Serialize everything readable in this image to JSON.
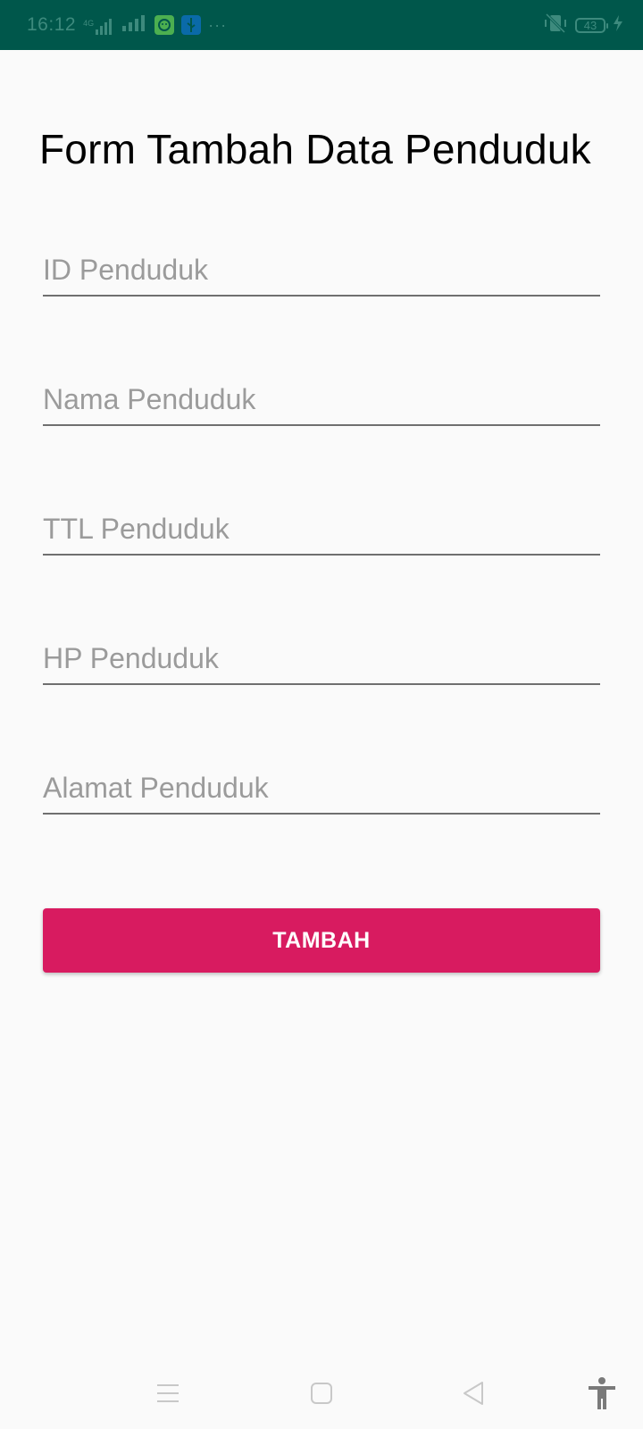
{
  "status_bar": {
    "time": "16:12",
    "network_label": "4G",
    "battery_level": "43",
    "icons": [
      "signal-icon",
      "app-notification-icon",
      "usb-icon",
      "more-dots-icon",
      "vibrate-icon",
      "battery-icon",
      "charging-icon"
    ]
  },
  "form": {
    "title": "Form Tambah Data Penduduk",
    "fields": [
      {
        "placeholder": "ID Penduduk",
        "value": ""
      },
      {
        "placeholder": "Nama Penduduk",
        "value": ""
      },
      {
        "placeholder": "TTL Penduduk",
        "value": ""
      },
      {
        "placeholder": "HP Penduduk",
        "value": ""
      },
      {
        "placeholder": "Alamat Penduduk",
        "value": ""
      }
    ],
    "submit_label": "TAMBAH"
  },
  "nav_bar": {
    "icons": [
      "menu-icon",
      "home-icon",
      "back-icon",
      "accessibility-icon"
    ]
  },
  "colors": {
    "status_bar": "#00574b",
    "accent": "#d81b60",
    "background": "#fafafa"
  }
}
